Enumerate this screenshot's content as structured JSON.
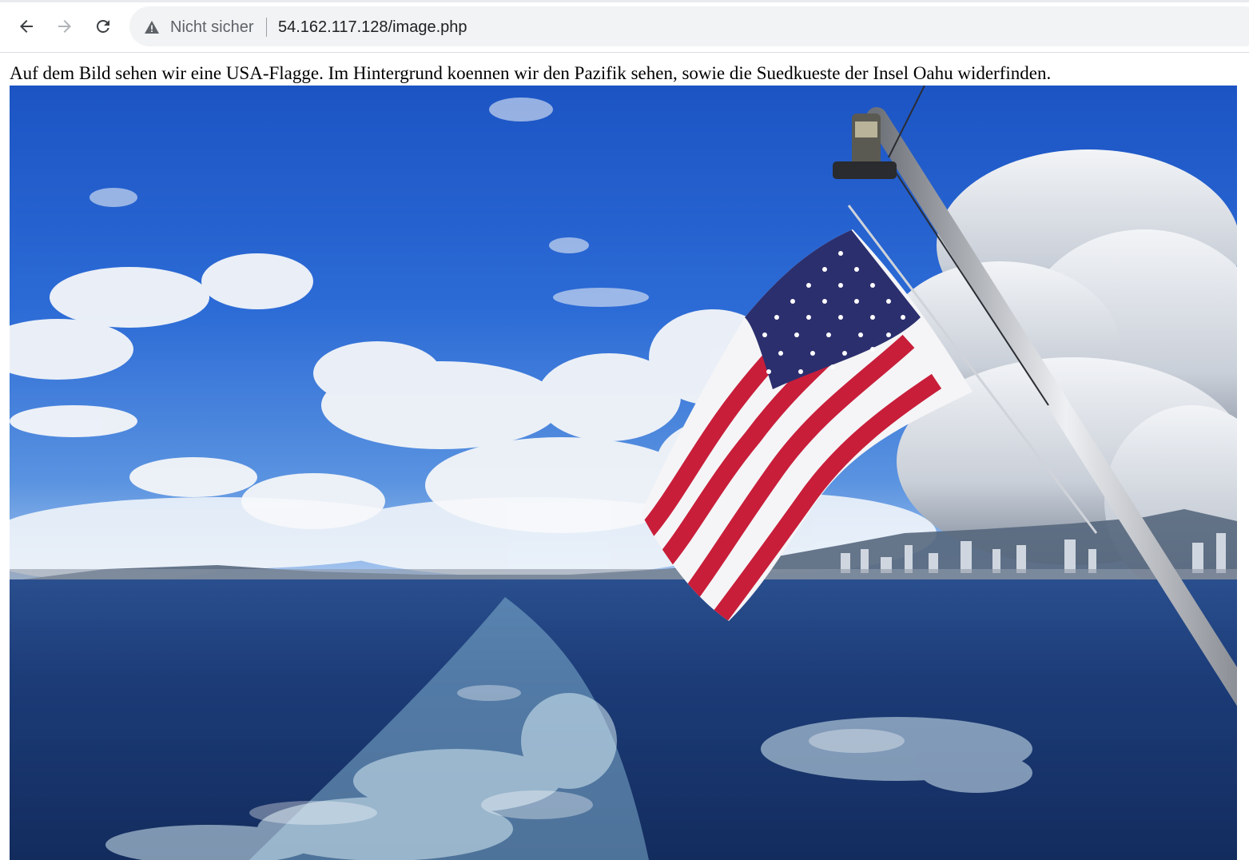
{
  "browser": {
    "security_label": "Nicht sicher",
    "url": "54.162.117.128/image.php",
    "icons": {
      "back": "arrow-left-icon",
      "forward": "arrow-right-icon",
      "reload": "reload-icon",
      "security": "warning-triangle-icon"
    }
  },
  "page": {
    "caption": "Auf dem Bild sehen wir eine USA-Flagge. Im Hintergrund koennen wir den Pazifik sehen, sowie die Suedkueste der Insel Oahu widerfinden."
  },
  "colors": {
    "sky": "#2a64d2",
    "ocean": "#1b3c78",
    "flag_red": "#c81e3a",
    "flag_blue": "#2b2f6e"
  }
}
